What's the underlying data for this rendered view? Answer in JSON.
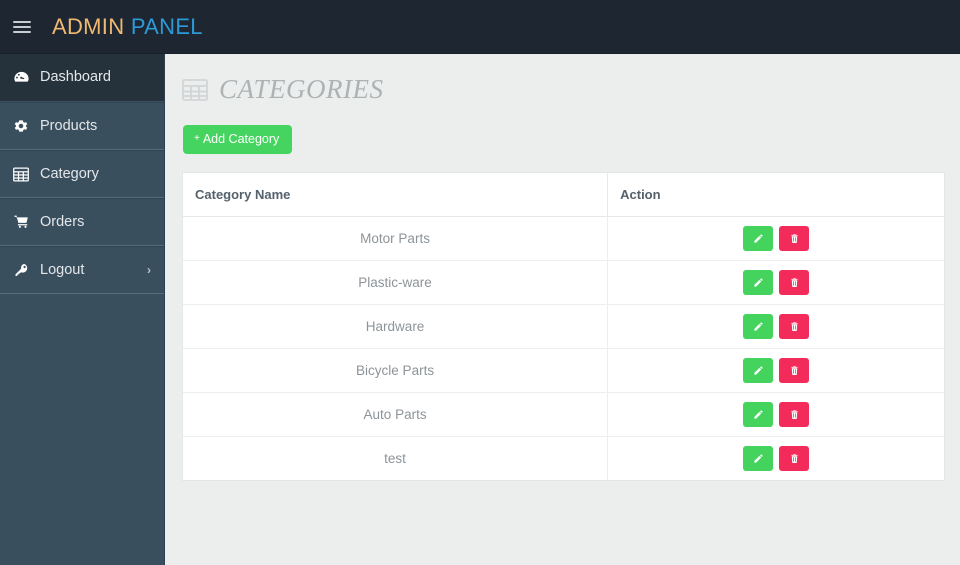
{
  "header": {
    "menu_icon": "hamburger-icon",
    "brand_part1": "ADMIN",
    "brand_part2": "PANEL",
    "brand_color1": "#f0b971",
    "brand_color2": "#2d9ad6",
    "background": "#1d2631"
  },
  "sidebar": {
    "background": "#3a4f5e",
    "active_background": "#26323b",
    "items": [
      {
        "label": "Dashboard",
        "icon": "dashboard-gauge-icon",
        "active": true,
        "caret": ""
      },
      {
        "label": "Products",
        "icon": "gear-icon",
        "active": false,
        "caret": ""
      },
      {
        "label": "Category",
        "icon": "table-grid-icon",
        "active": false,
        "caret": ""
      },
      {
        "label": "Orders",
        "icon": "shopping-cart-icon",
        "active": false,
        "caret": ""
      },
      {
        "label": "Logout",
        "icon": "key-icon",
        "active": false,
        "caret": "›"
      }
    ]
  },
  "main": {
    "page_title": "CATEGORIES",
    "page_icon": "table-grid-icon",
    "add_button": {
      "plus": "+",
      "label": "Add Category",
      "color": "#45d45f"
    },
    "table": {
      "columns": [
        "Category Name",
        "Action"
      ],
      "edit_icon": "pencil-icon",
      "delete_icon": "trash-icon",
      "edit_color": "#44d45e",
      "delete_color": "#f32b5b",
      "rows": [
        {
          "name": "Motor Parts"
        },
        {
          "name": "Plastic-ware"
        },
        {
          "name": "Hardware"
        },
        {
          "name": "Bicycle Parts"
        },
        {
          "name": "Auto Parts"
        },
        {
          "name": "test"
        }
      ]
    }
  }
}
